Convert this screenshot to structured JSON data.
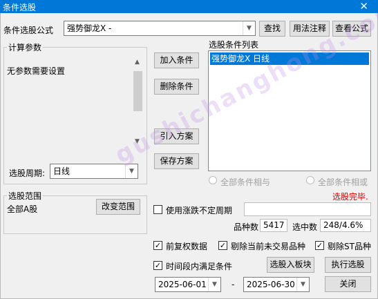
{
  "window": {
    "title": "条件选股",
    "close_glyph": "✕"
  },
  "formula": {
    "label": "条件选股公式",
    "value": "强势御龙X  -",
    "find_button": "查找",
    "usage_button": "用法注释",
    "view_button": "查看公式"
  },
  "params": {
    "title": "计算参数",
    "text": "无参数需要设置",
    "period_label": "选股周期:",
    "period_value": "日线"
  },
  "middle_buttons": {
    "add": "加入条件",
    "delete": "删除条件",
    "import": "引入方案",
    "save": "保存方案"
  },
  "condition_list": {
    "title": "选股条件列表",
    "items": [
      "强势御龙X  日线"
    ],
    "and_label": "全部条件相与",
    "or_label": "全部条件相或"
  },
  "status": {
    "text": "选股完毕.",
    "color": "#e00000"
  },
  "scope": {
    "title": "选股范围",
    "value": "全部A股",
    "change_button": "改变范围"
  },
  "variable_period": {
    "label": "使用涨跌不定周期",
    "checked": false,
    "value": ""
  },
  "stats": {
    "count_label": "品种数",
    "count_value": "5417",
    "hit_label": "选中数",
    "hit_value": "248/4.6%"
  },
  "options": {
    "pre_adjusted": "前复权数据",
    "exclude_untraded": "剔除当前未交易品种",
    "exclude_st": "剔除ST品种",
    "time_range": "时间段内满足条件"
  },
  "actions": {
    "to_block": "选股入板块",
    "execute": "执行选股",
    "close": "关闭"
  },
  "dates": {
    "start": "2025-06-01",
    "separator": "-",
    "end": "2025-06-30"
  },
  "watermark": "gushichanghong.com",
  "colors": {
    "accent": "#0078d7",
    "status": "#e00000"
  }
}
